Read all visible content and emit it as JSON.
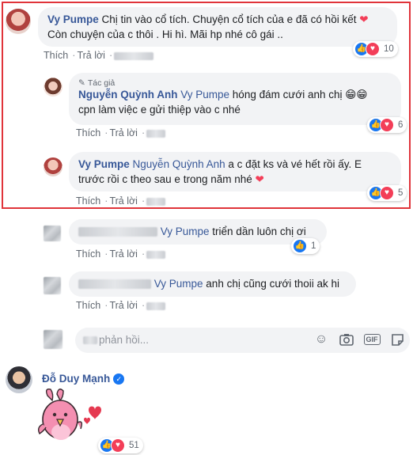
{
  "comment1": {
    "author": "Vy Pumpe",
    "text": " Chị tin vào cổ tích. Chuyện cổ tích của e đã có hồi kết ",
    "text2": "Còn chuyện của c thôi . Hi hì. Mãi hp nhé cô gái ..",
    "actions": {
      "like": "Thích",
      "reply": "Trả lời"
    },
    "reactions": {
      "count": "10"
    }
  },
  "reply1": {
    "badge": "Tác giả",
    "author": "Nguyễn Quỳnh Anh",
    "mention": "Vy Pumpe",
    "text": " hóng đám cưới anh chị ",
    "text2": "cpn làm việc e gửi thiệp vào c nhé",
    "actions": {
      "like": "Thích",
      "reply": "Trả lời"
    },
    "reactions": {
      "count": "6"
    }
  },
  "reply2": {
    "author": "Vy Pumpe",
    "mention": "Nguyễn Quỳnh Anh",
    "text": " a c đặt ks và vé hết rồi ấy. E",
    "text2": "trước rồi c theo sau e trong năm nhé ",
    "actions": {
      "like": "Thích",
      "reply": "Trả lời"
    },
    "reactions": {
      "count": "5"
    }
  },
  "reply3": {
    "mention": "Vy Pumpe",
    "text": " triển dần luôn chị ơi",
    "actions": {
      "like": "Thích",
      "reply": "Trả lời"
    },
    "reactions": {
      "count": "1"
    }
  },
  "reply4": {
    "mention": "Vy Pumpe",
    "text": " anh chị cũng cưới thoii ak hi",
    "actions": {
      "like": "Thích",
      "reply": "Trả lời"
    }
  },
  "reply_box": {
    "placeholder": "phản hồi..."
  },
  "comment2": {
    "author": "Đỗ Duy Mạnh",
    "reactions": {
      "count": "51"
    }
  },
  "colors": {
    "accent": "#385898",
    "like": "#1877f2",
    "love": "#f33e58",
    "highlight_border": "#e0343a"
  }
}
